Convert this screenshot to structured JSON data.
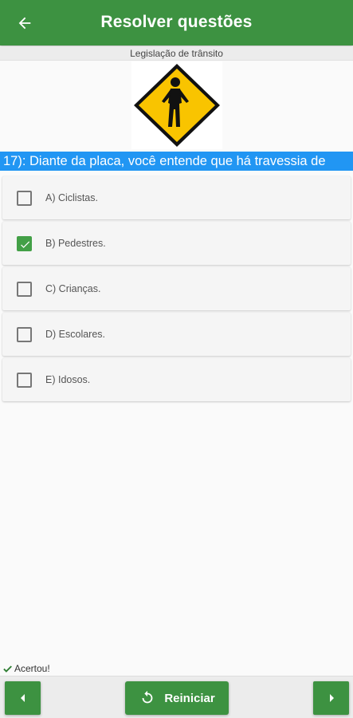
{
  "header": {
    "title": "Resolver questões",
    "back_icon": "arrow-left-icon"
  },
  "category": "Legislação de trânsito",
  "sign": {
    "icon": "pedestrian-crossing-sign",
    "color": "#f9c400"
  },
  "question": {
    "text": "17): Diante da placa, você entende que há travessia de"
  },
  "options": [
    {
      "label": "A) Ciclistas.",
      "checked": false
    },
    {
      "label": "B) Pedestres.",
      "checked": true
    },
    {
      "label": "C) Crianças.",
      "checked": false
    },
    {
      "label": "D) Escolares.",
      "checked": false
    },
    {
      "label": "E) Idosos.",
      "checked": false
    }
  ],
  "status": {
    "text": "Acertou!",
    "icon": "checkmark-icon"
  },
  "footer": {
    "prev_icon": "caret-left-icon",
    "restart_label": "Reiniciar",
    "restart_icon": "restart-icon",
    "next_icon": "caret-right-icon"
  },
  "colors": {
    "primary": "#3d9241",
    "question_bg": "#2196f3",
    "check": "#43a047"
  }
}
